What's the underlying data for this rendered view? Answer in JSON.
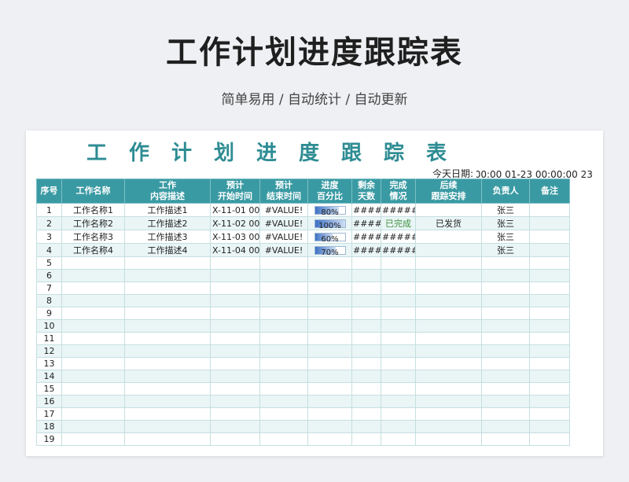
{
  "page": {
    "title": "工作计划进度跟踪表",
    "subtitle": "简单易用 / 自动统计 / 自动更新"
  },
  "sheet": {
    "title": "工作计划进度跟踪表",
    "today_label": "今天日期:",
    "today_value": "23 00:00:00 01-23 00:00:00"
  },
  "colors": {
    "header": "#3a9aa3",
    "title": "#2e8c93",
    "done": "#3b8f3b"
  },
  "columns": [
    [
      "序号",
      ""
    ],
    [
      "工作名称",
      ""
    ],
    [
      "工作",
      "内容描述"
    ],
    [
      "预计",
      "开始时间"
    ],
    [
      "预计",
      "结束时间"
    ],
    [
      "进度",
      "百分比"
    ],
    [
      "剩余",
      "天数"
    ],
    [
      "完成",
      "情况"
    ],
    [
      "后续",
      "跟踪安排"
    ],
    [
      "负责人",
      ""
    ],
    [
      "备注",
      ""
    ]
  ],
  "rows": [
    {
      "no": "1",
      "name": "工作名称1",
      "desc": "工作描述1",
      "start": "X-11-01 00:0",
      "end": "#VALUE!",
      "progress": "80%",
      "progress_value": 80,
      "remain": "#####",
      "status": "######",
      "follow": "",
      "owner": "张三",
      "note": ""
    },
    {
      "no": "2",
      "name": "工作名称2",
      "desc": "工作描述2",
      "start": "X-11-02 00:0",
      "end": "#VALUE!",
      "progress": "100%",
      "progress_value": 100,
      "remain": "#####",
      "status": "已完成",
      "follow": "已发货",
      "owner": "张三",
      "note": ""
    },
    {
      "no": "3",
      "name": "工作名称3",
      "desc": "工作描述3",
      "start": "X-11-03 00:0",
      "end": "#VALUE!",
      "progress": "60%",
      "progress_value": 60,
      "remain": "#####",
      "status": "######",
      "follow": "",
      "owner": "张三",
      "note": ""
    },
    {
      "no": "4",
      "name": "工作名称4",
      "desc": "工作描述4",
      "start": "X-11-04 00:0",
      "end": "#VALUE!",
      "progress": "70%",
      "progress_value": 70,
      "remain": "#####",
      "status": "######",
      "follow": "",
      "owner": "张三",
      "note": ""
    }
  ],
  "empty_row_numbers": [
    "5",
    "6",
    "7",
    "8",
    "9",
    "10",
    "11",
    "12",
    "13",
    "14",
    "15",
    "16",
    "17",
    "18",
    "19"
  ]
}
